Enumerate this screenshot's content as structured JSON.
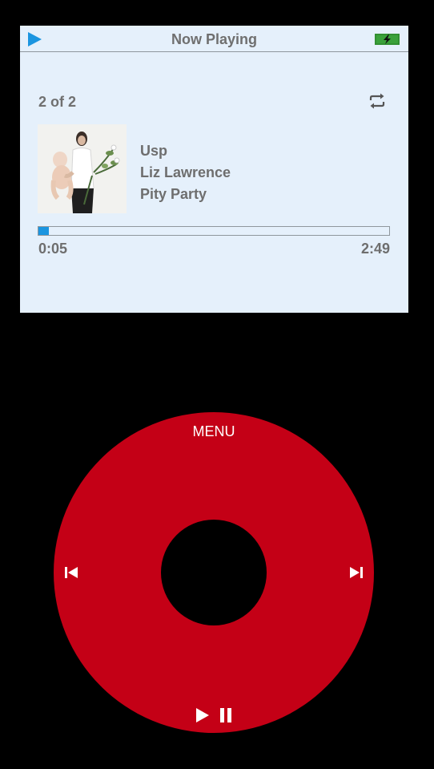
{
  "screen": {
    "title": "Now Playing",
    "play_state_icon": "play-icon",
    "battery_icon": "battery-charging-icon",
    "colors": {
      "background": "#e5f0fb",
      "accent": "#1b95e0",
      "battery": "#3aa13a",
      "text": "#6e6e6e"
    }
  },
  "now_playing": {
    "position_label": "2 of 2",
    "repeat_icon": "repeat-icon",
    "album_art_icon": "album-art-image",
    "song": "Usp",
    "artist": "Liz Lawrence",
    "album": "Pity Party",
    "elapsed": "0:05",
    "duration": "2:49",
    "progress_fraction": 0.03
  },
  "wheel": {
    "menu_label": "MENU",
    "prev_icon": "skip-previous-icon",
    "next_icon": "skip-next-icon",
    "play_pause_icon": "play-pause-icon",
    "colors": {
      "wheel": "#c40016",
      "center": "#000000",
      "label": "#ffffff"
    }
  }
}
